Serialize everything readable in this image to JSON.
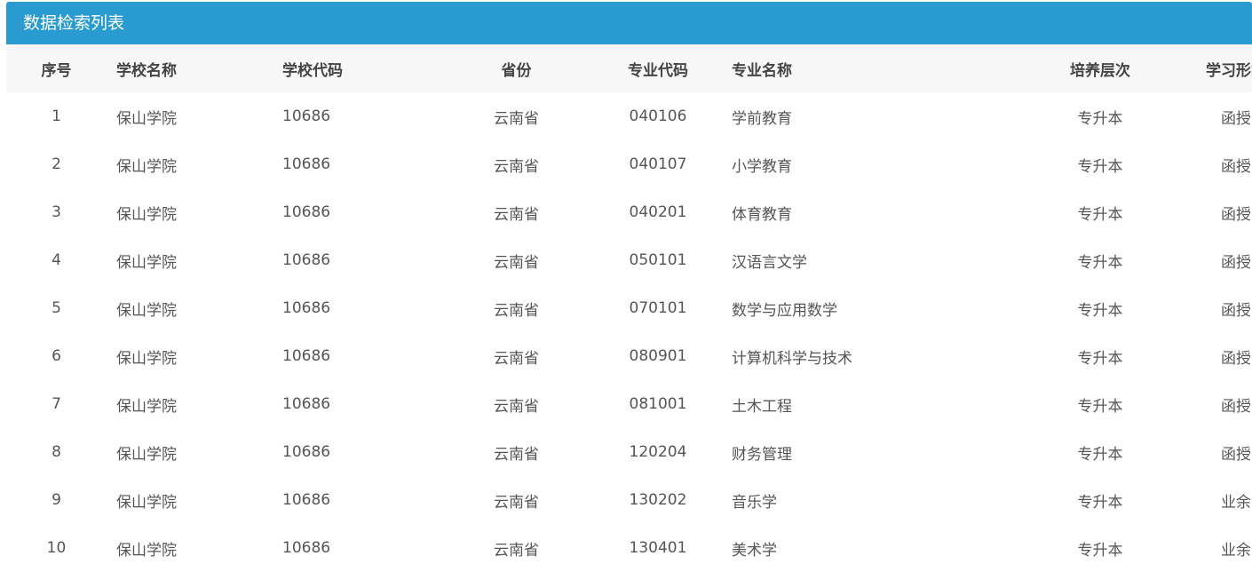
{
  "panel": {
    "title": "数据检索列表"
  },
  "table": {
    "headers": {
      "index": "序号",
      "school_name": "学校名称",
      "school_code": "学校代码",
      "province": "省份",
      "major_code": "专业代码",
      "major_name": "专业名称",
      "level": "培养层次",
      "study_mode": "学习形式"
    },
    "rows": [
      {
        "index": "1",
        "school_name": "保山学院",
        "school_code": "10686",
        "province": "云南省",
        "major_code": "040106",
        "major_name": "学前教育",
        "level": "专升本",
        "study_mode": "函授"
      },
      {
        "index": "2",
        "school_name": "保山学院",
        "school_code": "10686",
        "province": "云南省",
        "major_code": "040107",
        "major_name": "小学教育",
        "level": "专升本",
        "study_mode": "函授"
      },
      {
        "index": "3",
        "school_name": "保山学院",
        "school_code": "10686",
        "province": "云南省",
        "major_code": "040201",
        "major_name": "体育教育",
        "level": "专升本",
        "study_mode": "函授"
      },
      {
        "index": "4",
        "school_name": "保山学院",
        "school_code": "10686",
        "province": "云南省",
        "major_code": "050101",
        "major_name": "汉语言文学",
        "level": "专升本",
        "study_mode": "函授"
      },
      {
        "index": "5",
        "school_name": "保山学院",
        "school_code": "10686",
        "province": "云南省",
        "major_code": "070101",
        "major_name": "数学与应用数学",
        "level": "专升本",
        "study_mode": "函授"
      },
      {
        "index": "6",
        "school_name": "保山学院",
        "school_code": "10686",
        "province": "云南省",
        "major_code": "080901",
        "major_name": "计算机科学与技术",
        "level": "专升本",
        "study_mode": "函授"
      },
      {
        "index": "7",
        "school_name": "保山学院",
        "school_code": "10686",
        "province": "云南省",
        "major_code": "081001",
        "major_name": "土木工程",
        "level": "专升本",
        "study_mode": "函授"
      },
      {
        "index": "8",
        "school_name": "保山学院",
        "school_code": "10686",
        "province": "云南省",
        "major_code": "120204",
        "major_name": "财务管理",
        "level": "专升本",
        "study_mode": "函授"
      },
      {
        "index": "9",
        "school_name": "保山学院",
        "school_code": "10686",
        "province": "云南省",
        "major_code": "130202",
        "major_name": "音乐学",
        "level": "专升本",
        "study_mode": "业余"
      },
      {
        "index": "10",
        "school_name": "保山学院",
        "school_code": "10686",
        "province": "云南省",
        "major_code": "130401",
        "major_name": "美术学",
        "level": "专升本",
        "study_mode": "业余"
      }
    ]
  },
  "colors": {
    "header_bar": "#2a9bd0",
    "table_head_bg": "#f7f7f7"
  }
}
